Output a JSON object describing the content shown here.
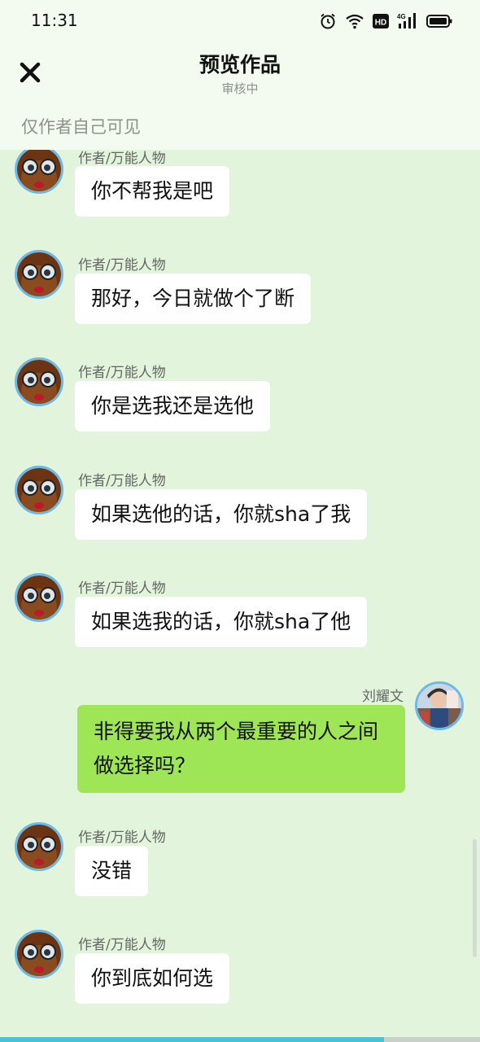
{
  "status_bar": {
    "time": "11:31",
    "network_label": "4G",
    "icons": [
      "alarm-icon",
      "wifi-icon",
      "hd-icon",
      "signal-icon",
      "battery-icon"
    ]
  },
  "header": {
    "close_icon": "close-icon",
    "title": "预览作品",
    "subtitle": "审核中"
  },
  "notice": "仅作者自己可见",
  "messages": [
    {
      "side": "left",
      "sender": "作者/万能人物",
      "text": "你不帮我是吧"
    },
    {
      "side": "left",
      "sender": "作者/万能人物",
      "text": "那好，今日就做个了断"
    },
    {
      "side": "left",
      "sender": "作者/万能人物",
      "text": "你是选我还是选他"
    },
    {
      "side": "left",
      "sender": "作者/万能人物",
      "text": "如果选他的话，你就sha了我"
    },
    {
      "side": "left",
      "sender": "作者/万能人物",
      "text": "如果选我的话，你就sha了他"
    },
    {
      "side": "right",
      "sender": "刘耀文",
      "text": "非得要我从两个最重要的人之间做选择吗？"
    },
    {
      "side": "left",
      "sender": "作者/万能人物",
      "text": "没错"
    },
    {
      "side": "left",
      "sender": "作者/万能人物",
      "text": "你到底如何选"
    }
  ],
  "reading_progress": 0.8,
  "colors": {
    "background": "#e3f4dc",
    "header_background": "#f3fbf0",
    "left_bubble": "#ffffff",
    "right_bubble": "#9fe657",
    "avatar_ring": "#6cb9e8",
    "progress": "#46c3d6"
  }
}
